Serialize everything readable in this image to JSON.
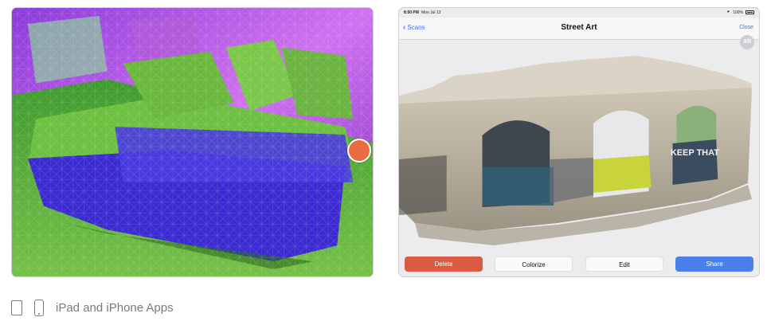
{
  "left_screenshot": {
    "mesh_colors": {
      "floor": "#5fae3c",
      "sofa": "#3a2ad0",
      "wall": "#c060e8",
      "wire": "#ff7ad0"
    },
    "capture_button_color": "#ec6a3f"
  },
  "right_screenshot": {
    "status_bar": {
      "time": "8:50 PM",
      "date": "Mon Jul 13",
      "battery": "100%"
    },
    "nav": {
      "back_label": "Scans",
      "title": "Street Art",
      "close_label": "Close"
    },
    "ar_button_label": "AR",
    "graffiti_text": "KEEP THAT",
    "actions": {
      "delete": "Delete",
      "colorize": "Colorize",
      "edit": "Edit",
      "share": "Share"
    },
    "colors": {
      "delete": "#dc5a42",
      "share": "#4b80ea",
      "link": "#2f7cf6"
    }
  },
  "caption": {
    "text": "iPad and iPhone Apps"
  }
}
